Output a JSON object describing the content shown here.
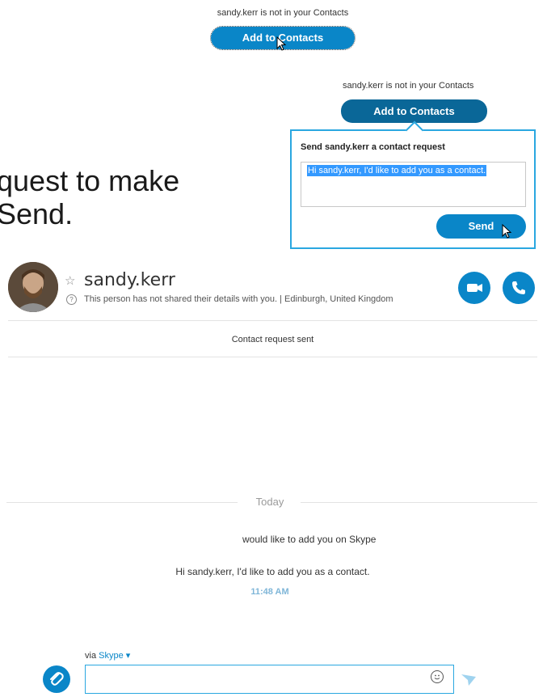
{
  "top": {
    "note": "sandy.kerr is not in your Contacts",
    "add_button": "Add to Contacts"
  },
  "popup_panel": {
    "note": "sandy.kerr is not in your Contacts",
    "add_button": "Add to Contacts",
    "title": "Send sandy.kerr a contact request",
    "message": "Hi sandy.kerr, I'd like to add you as a contact.",
    "send_button": "Send"
  },
  "slide_text": {
    "line1": "quest to make",
    "line2": "Send."
  },
  "conversation": {
    "contact_name": "sandy.kerr",
    "details": "This person has not shared their details with you.  |  Edinburgh, United Kingdom",
    "status": "Contact request sent",
    "divider": "Today",
    "request_text": "would like to add you on Skype",
    "message": "Hi sandy.kerr, I'd like to add you as a contact.",
    "time": "11:48 AM"
  },
  "compose": {
    "via_label": "via",
    "via_service": "Skype"
  },
  "colors": {
    "accent": "#0a86c8",
    "accent_dark": "#0a6798",
    "border": "#2aa7e0"
  }
}
